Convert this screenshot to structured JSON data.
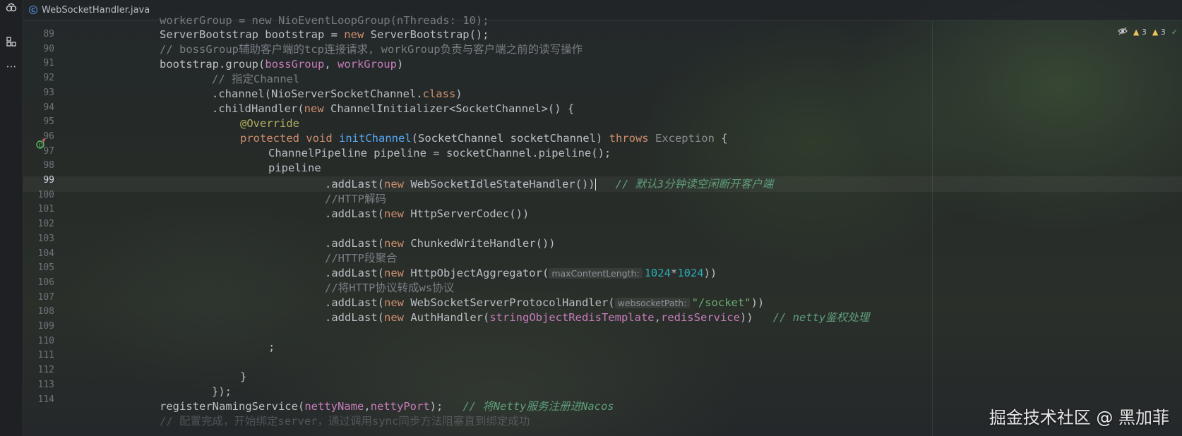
{
  "activity_bar": {
    "icons": [
      "copilot-icon",
      "structure-icon",
      "more-icon"
    ],
    "more_glyph": "⋯"
  },
  "tab": {
    "file_name": "WebSocketHandler.java",
    "icon": "class-icon"
  },
  "inspections": {
    "warnings_a": "3",
    "warnings_b": "3",
    "icon_a": "warning-icon",
    "icon_b": "warning-icon",
    "ok_icon": "check-icon"
  },
  "colors": {
    "keyword": "#cf8e6d",
    "field": "#c77dbb",
    "comment": "#7a7e85",
    "doc_comment": "#5f9e7a",
    "annotation": "#b3ae60",
    "function": "#56a8f5",
    "number": "#2aacb8",
    "string": "#6aab73"
  },
  "editor": {
    "current_line": 99,
    "line_numbers": [
      "89",
      "90",
      "91",
      "92",
      "93",
      "94",
      "95",
      "96",
      "97",
      "98",
      "99",
      "100",
      "101",
      "102",
      "103",
      "104",
      "105",
      "106",
      "107",
      "108",
      "109",
      "110",
      "111",
      "112",
      "113",
      "114"
    ],
    "top_partial_text": "workerGroup = new NioEventLoopGroup(nThreads: 10);",
    "lines": {
      "l89": {
        "a": "ServerBootstrap bootstrap = ",
        "b": "new",
        "c": " ServerBootstrap();"
      },
      "l90": {
        "a": "// bossGroup辅助客户端的tcp连接请求, workGroup负责与客户端之前的读写操作"
      },
      "l91": {
        "a": "bootstrap.group(",
        "b": "bossGroup",
        "c": ", ",
        "d": "workGroup",
        "e": ")"
      },
      "l92": {
        "a": "// 指定Channel"
      },
      "l93": {
        "a": ".channel(NioServerSocketChannel.",
        "b": "class",
        "c": ")"
      },
      "l94": {
        "a": ".childHandler(",
        "b": "new",
        "c": " ChannelInitializer<SocketChannel>() {"
      },
      "l95": {
        "a": "@Override"
      },
      "l96": {
        "a": "protected",
        "b": " ",
        "c": "void",
        "d": " ",
        "e": "initChannel",
        "f": "(SocketChannel socketChannel) ",
        "g": "throws",
        "h": " ",
        "i": "Exception",
        "j": " {"
      },
      "l97": {
        "a": "ChannelPipeline pipeline = socketChannel.pipeline();"
      },
      "l98": {
        "a": "pipeline"
      },
      "l99": {
        "a": ".addLast(",
        "b": "new",
        "c": " WebSocketIdleStateHandler())",
        "d": "// 默认3分钟读空闲断开客户端"
      },
      "l100": {
        "a": "//HTTP解码"
      },
      "l101": {
        "a": ".addLast(",
        "b": "new",
        "c": " HttpServerCodec())"
      },
      "l103": {
        "a": ".addLast(",
        "b": "new",
        "c": " ChunkedWriteHandler())"
      },
      "l104": {
        "a": "//HTTP段聚合"
      },
      "l105": {
        "a": ".addLast(",
        "b": "new",
        "c": " HttpObjectAggregator(",
        "hint": "maxContentLength:",
        "d": "1024",
        "e": "*",
        "f": "1024",
        "g": "))"
      },
      "l106": {
        "a": "//将HTTP协议转成ws协议"
      },
      "l107": {
        "a": ".addLast(",
        "b": "new",
        "c": " WebSocketServerProtocolHandler(",
        "hint": "websocketPath:",
        "d": "\"/socket\"",
        "e": "))"
      },
      "l108": {
        "a": ".addLast(",
        "b": "new",
        "c": " AuthHandler(",
        "d": "stringObjectRedisTemplate",
        "e": ",",
        "f": "redisService",
        "g": "))",
        "h": "// netty鉴权处理"
      },
      "l110": {
        "a": ";"
      },
      "l112": {
        "a": "}"
      },
      "l113": {
        "a": "});"
      },
      "l114": {
        "a": "registerNamingService(",
        "b": "nettyName",
        "c": ",",
        "d": "nettyPort",
        "e": ");",
        "f": "// 将Netty服务注册进Nacos"
      }
    },
    "bottom_partial_text": "// 配置完成，开始绑定server，通过调用sync同步方法阻塞直到绑定成功"
  },
  "watermark": "掘金技术社区 @ 黑加菲"
}
